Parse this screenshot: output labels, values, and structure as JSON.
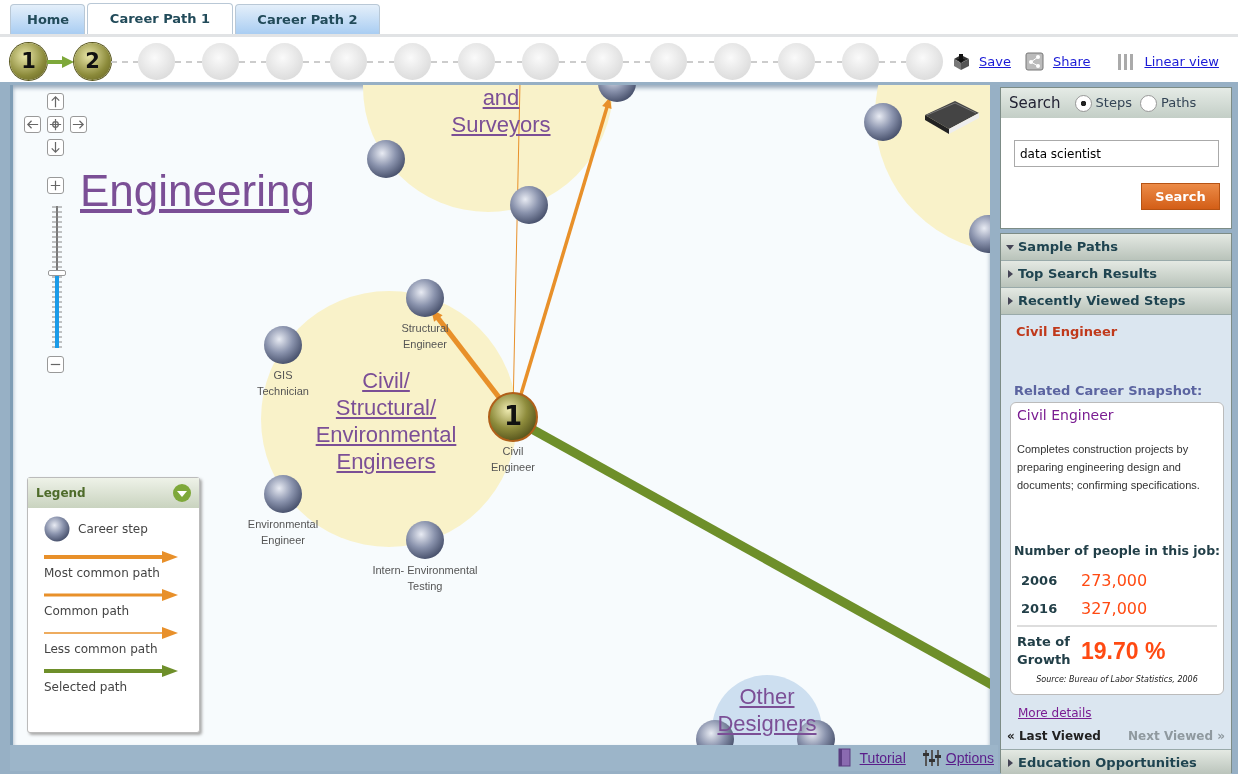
{
  "tabs": [
    {
      "label": "Home",
      "selected": false
    },
    {
      "label": "Career Path 1",
      "selected": true
    },
    {
      "label": "Career Path 2",
      "selected": false
    }
  ],
  "steps": [
    {
      "label": "1",
      "filled": true
    },
    {
      "label": "2",
      "filled": true
    },
    {
      "filled": false
    },
    {
      "filled": false
    },
    {
      "filled": false
    },
    {
      "filled": false
    },
    {
      "filled": false
    },
    {
      "filled": false
    },
    {
      "filled": false
    },
    {
      "filled": false
    },
    {
      "filled": false
    },
    {
      "filled": false
    },
    {
      "filled": false
    },
    {
      "filled": false
    },
    {
      "filled": false
    }
  ],
  "toolbar_links": [
    {
      "label": "Save",
      "kind": "save"
    },
    {
      "label": "Share",
      "kind": "share"
    },
    {
      "label": "Linear view",
      "kind": "linear"
    }
  ],
  "map": {
    "title": "Engineering",
    "zoom": {
      "level": 0.53
    },
    "clusters": [
      {
        "lines": [
          "and",
          "Surveyors"
        ],
        "color": "#f9f2c9"
      },
      {
        "lines": [
          "Civil/",
          "Structural/",
          "Environmental",
          "Engineers"
        ],
        "color": "#f9f2c9"
      },
      {
        "color": "#f9f2c9"
      },
      {
        "lines": [
          "Other",
          "Designers"
        ],
        "color": "#cddff0"
      }
    ],
    "edges": [
      {
        "kind": "most_common"
      },
      {
        "kind": "common"
      },
      {
        "kind": "less_common"
      },
      {
        "kind": "selected"
      }
    ],
    "nodes": [
      {
        "kind": "career_step"
      },
      {
        "kind": "career_step"
      },
      {
        "kind": "career_step"
      },
      {
        "kind": "career_step"
      },
      {
        "kind": "career_step"
      },
      {
        "kind": "career_step",
        "lines": [
          "Structural",
          "Engineer"
        ]
      },
      {
        "kind": "career_step",
        "lines": [
          "GIS",
          "Technician"
        ]
      },
      {
        "kind": "current_step",
        "number": "1",
        "lines": [
          "Civil",
          "Engineer"
        ]
      },
      {
        "kind": "career_step",
        "lines": [
          "Environmental",
          "Engineer"
        ]
      },
      {
        "kind": "career_step",
        "lines": [
          "Intern- Environmental",
          "Testing"
        ]
      },
      {
        "kind": "career_step"
      },
      {
        "kind": "career_step"
      }
    ],
    "legend": {
      "title": "Legend",
      "items": [
        {
          "kind": "step",
          "label": "Career step"
        },
        {
          "kind": "most_common",
          "label": "Most common path"
        },
        {
          "kind": "common",
          "label": "Common path"
        },
        {
          "kind": "less_common",
          "label": "Less common path"
        },
        {
          "kind": "selected",
          "label": "Selected path"
        }
      ]
    }
  },
  "search": {
    "title": "Search",
    "options": [
      {
        "label": "Steps",
        "selected": true
      },
      {
        "label": "Paths",
        "selected": false
      }
    ],
    "value": "data scientist",
    "button": "Search"
  },
  "sections": [
    {
      "label": "Sample Paths",
      "expanded": true
    },
    {
      "label": "Top Search Results",
      "expanded": false
    },
    {
      "label": "Recently Viewed Steps",
      "expanded": false
    }
  ],
  "recent": {
    "step": "Civil Engineer",
    "snapshot_heading": "Related Career Snapshot:",
    "snapshot": {
      "title": "Civil Engineer",
      "description": "Completes construction projects by preparing engineering design and documents; confirming specifications.",
      "people_heading": "Number of people in this job:",
      "rows": [
        {
          "year": "2006",
          "count": "273,000"
        },
        {
          "year": "2016",
          "count": "327,000"
        }
      ],
      "growth_label": "Rate of Growth",
      "growth": "19.70 %",
      "source": "Source: Bureau of Labor Statistics, 2006"
    },
    "more": "More details",
    "last": {
      "label": "« Last Viewed",
      "disabled": false
    },
    "next": {
      "label": "Next Viewed »",
      "disabled": true
    }
  },
  "bottom_section": {
    "label": "Education Opportunities",
    "expanded": false
  },
  "footer_links": [
    {
      "label": "Tutorial",
      "kind": "tutorial"
    },
    {
      "label": "Options",
      "kind": "options"
    }
  ]
}
